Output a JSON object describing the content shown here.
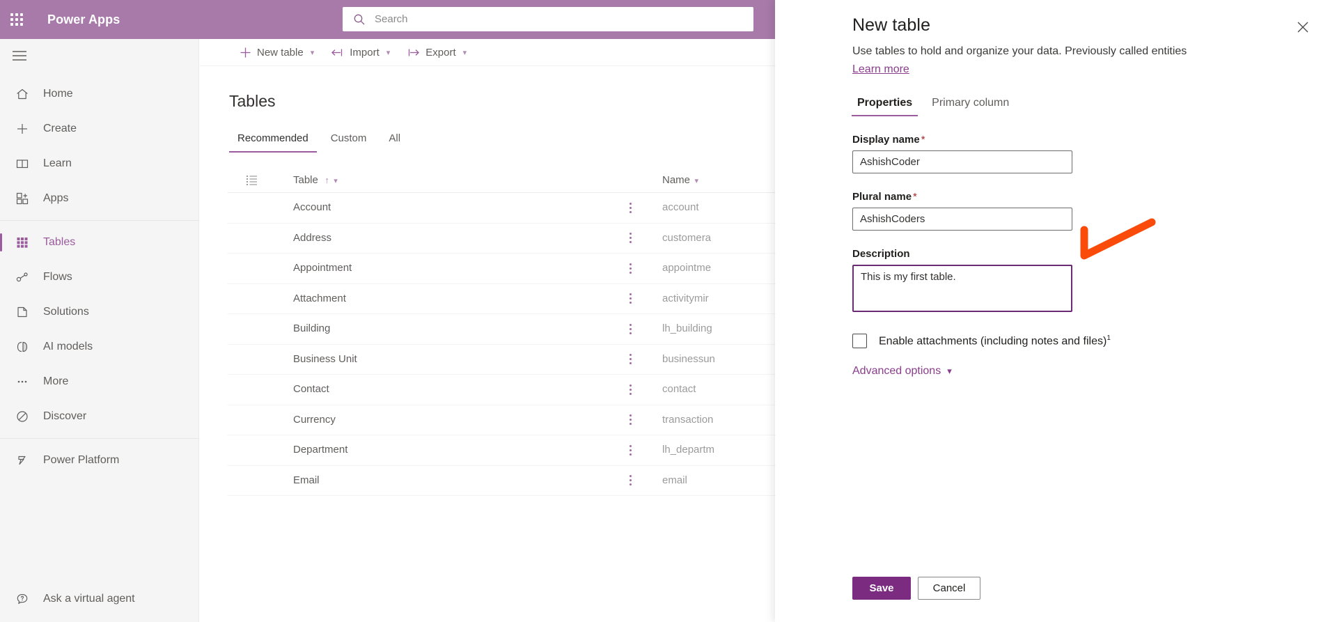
{
  "header": {
    "waffle_icon": "app-launcher-icon",
    "brand": "Power Apps",
    "search": {
      "icon": "search-icon",
      "placeholder": "Search",
      "value": ""
    }
  },
  "sidebar": {
    "hamburger_icon": "hamburger-menu-icon",
    "items": [
      {
        "label": "Home",
        "icon": "home-icon",
        "active": false
      },
      {
        "label": "Create",
        "icon": "plus-icon",
        "active": false
      },
      {
        "label": "Learn",
        "icon": "book-icon",
        "active": false
      },
      {
        "label": "Apps",
        "icon": "apps-icon",
        "active": false
      },
      {
        "label": "Tables",
        "icon": "tables-grid-icon",
        "active": true
      },
      {
        "label": "Flows",
        "icon": "flows-icon",
        "active": false
      },
      {
        "label": "Solutions",
        "icon": "solutions-icon",
        "active": false
      },
      {
        "label": "AI models",
        "icon": "ai-brain-icon",
        "active": false
      },
      {
        "label": "More",
        "icon": "ellipsis-icon",
        "active": false
      },
      {
        "label": "Discover",
        "icon": "discover-compass-icon",
        "active": false
      },
      {
        "label": "Power Platform",
        "icon": "power-platform-icon",
        "active": false
      }
    ],
    "bottom_item": {
      "label": "Ask a virtual agent",
      "icon": "question-chat-icon"
    }
  },
  "command_bar": [
    {
      "label": "New table",
      "icon": "plus-icon",
      "has_chevron": true
    },
    {
      "label": "Import",
      "icon": "import-arrow-icon",
      "has_chevron": true
    },
    {
      "label": "Export",
      "icon": "export-arrow-icon",
      "has_chevron": true
    }
  ],
  "main": {
    "page_title": "Tables",
    "tabs": [
      {
        "label": "Recommended",
        "active": true
      },
      {
        "label": "Custom",
        "active": false
      },
      {
        "label": "All",
        "active": false
      }
    ],
    "grid": {
      "select_icon": "select-all-rows-icon",
      "columns": [
        {
          "label": "Table",
          "sort": "↑",
          "chevron": "⌄"
        },
        {
          "label": "Name",
          "sort": "",
          "chevron": "⌄"
        }
      ],
      "rows": [
        {
          "table": "Account",
          "name": "account"
        },
        {
          "table": "Address",
          "name": "customera"
        },
        {
          "table": "Appointment",
          "name": "appointme"
        },
        {
          "table": "Attachment",
          "name": "activitymir"
        },
        {
          "table": "Building",
          "name": "lh_building"
        },
        {
          "table": "Business Unit",
          "name": "businessun"
        },
        {
          "table": "Contact",
          "name": "contact"
        },
        {
          "table": "Currency",
          "name": "transaction"
        },
        {
          "table": "Department",
          "name": "lh_departm"
        },
        {
          "table": "Email",
          "name": "email"
        }
      ]
    }
  },
  "panel": {
    "title": "New table",
    "subtitle": "Use tables to hold and organize your data. Previously called entities",
    "learn_more": "Learn more",
    "close_icon": "close-icon",
    "tabs": [
      {
        "label": "Properties",
        "active": true
      },
      {
        "label": "Primary column",
        "active": false
      }
    ],
    "fields": {
      "display_name": {
        "label": "Display name",
        "required": "*",
        "value": "AshishCoder",
        "placeholder": ""
      },
      "plural_name": {
        "label": "Plural name",
        "required": "*",
        "value": "AshishCoders",
        "placeholder": ""
      },
      "description": {
        "label": "Description",
        "required": "",
        "value": "This is my first table.",
        "placeholder": ""
      }
    },
    "checkbox": {
      "label": "Enable attachments (including notes and files)",
      "footnote": "1",
      "checked": false
    },
    "advanced_options": {
      "label": "Advanced options",
      "chevron": "⌄"
    },
    "buttons": {
      "save": "Save",
      "cancel": "Cancel"
    }
  },
  "annotation": {
    "type": "checkmark",
    "color": "#FA4B0A"
  },
  "colors": {
    "header_purple": "#a77aa9",
    "accent_purple": "#9a5c9c",
    "primary_button": "#7b2b80",
    "focus_border": "#6b2a74",
    "required_red": "#a4262c",
    "annotation_orange": "#FA4B0A"
  }
}
